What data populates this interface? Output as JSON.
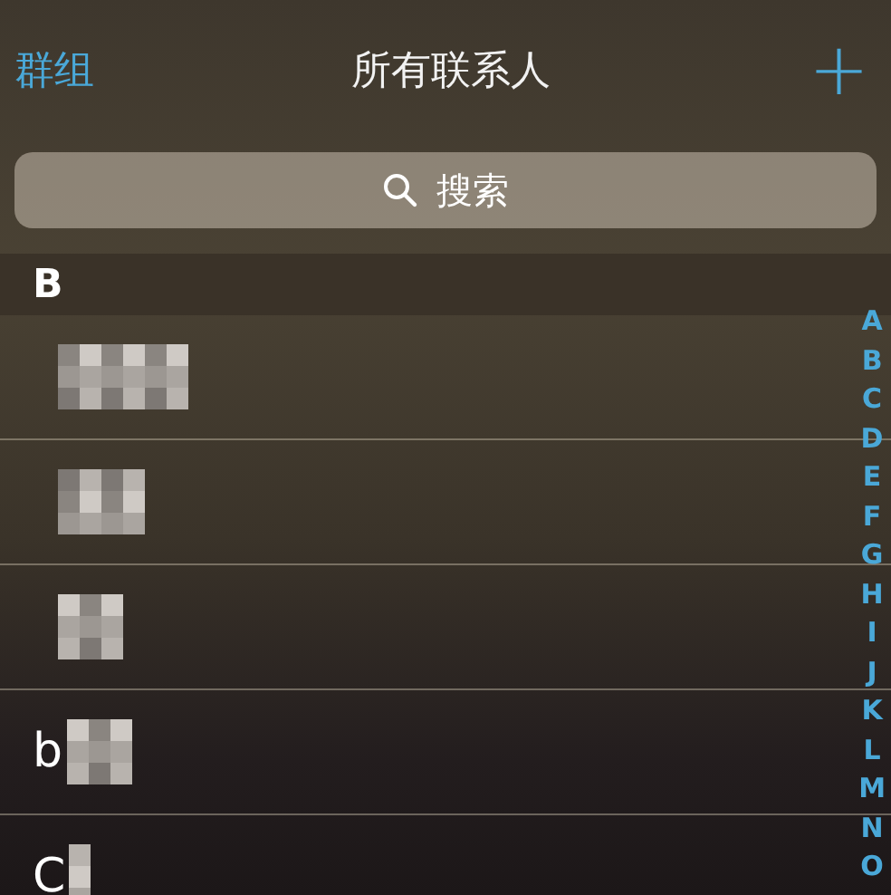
{
  "nav": {
    "back": "群组",
    "title": "所有联系人",
    "add": "+"
  },
  "search": {
    "placeholder": "搜索"
  },
  "section": {
    "title": "B"
  },
  "rows": [
    {
      "kind": "redacted"
    },
    {
      "kind": "redacted"
    },
    {
      "kind": "redacted"
    },
    {
      "kind": "redacted",
      "name": "b"
    },
    {
      "kind": "redacted",
      "name": "C"
    }
  ],
  "index": [
    "A",
    "B",
    "C",
    "D",
    "E",
    "F",
    "G",
    "H",
    "I",
    "J",
    "K",
    "L",
    "M",
    "N",
    "O"
  ]
}
